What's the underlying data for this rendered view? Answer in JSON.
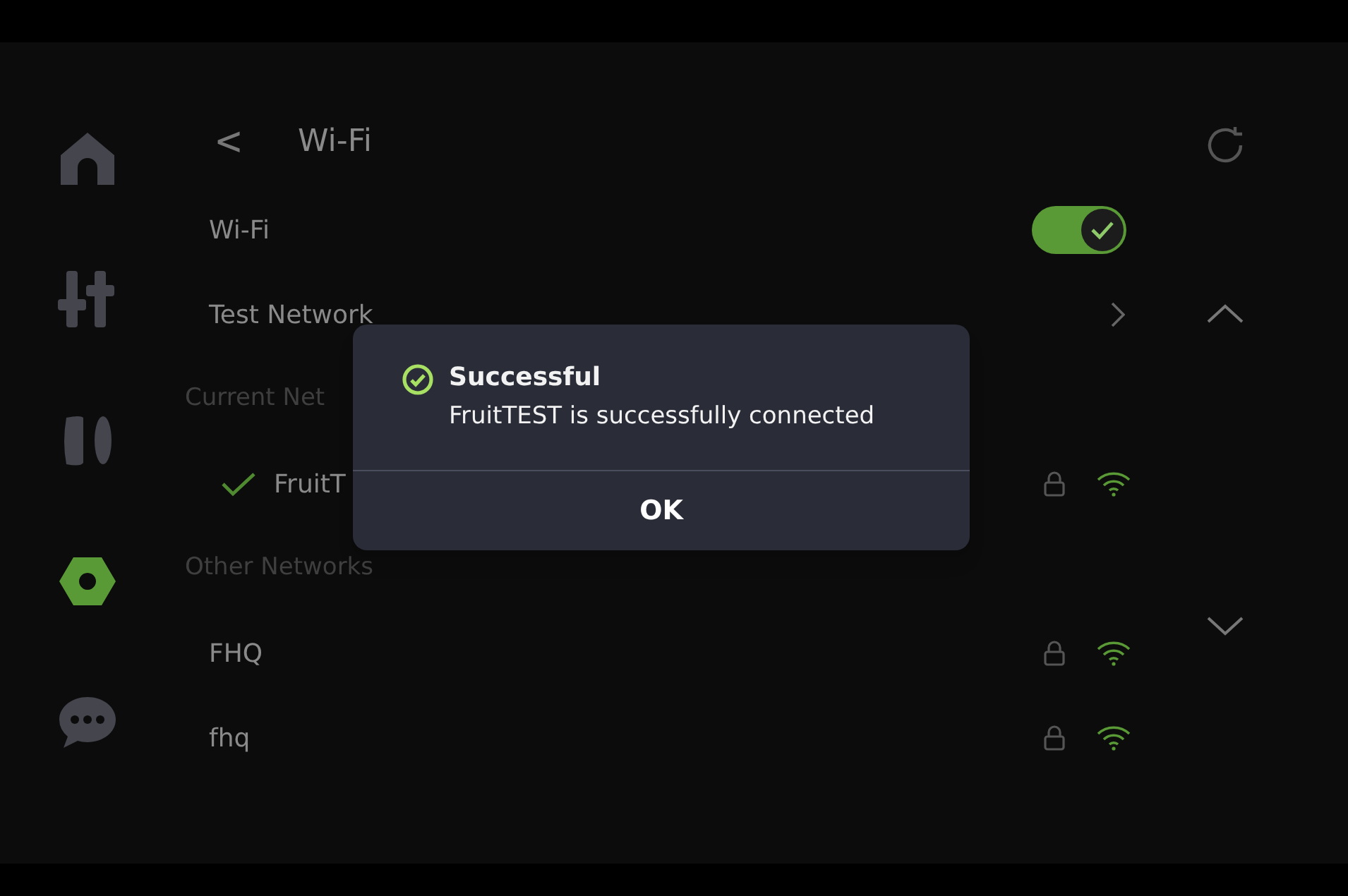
{
  "sidebar": {
    "items": [
      {
        "kind": "home",
        "selected": false
      },
      {
        "kind": "sliders",
        "selected": false
      },
      {
        "kind": "spool",
        "selected": false
      },
      {
        "kind": "nut",
        "selected": true
      },
      {
        "kind": "chat",
        "selected": false
      }
    ]
  },
  "header": {
    "back": "<",
    "title": "Wi-Fi"
  },
  "wifi_toggle": {
    "label": "Wi-Fi",
    "on": true
  },
  "test_network": {
    "label": "Test Network"
  },
  "current_network": {
    "section_label": "Current Net",
    "networks": [
      {
        "name": "FruitT",
        "connected": true,
        "secured": true
      }
    ]
  },
  "other_networks": {
    "section_label": "Other Networks",
    "networks": [
      {
        "name": "FHQ",
        "connected": false,
        "secured": true
      },
      {
        "name": "fhq",
        "connected": false,
        "secured": true
      }
    ]
  },
  "dialog": {
    "title": "Successful",
    "message": "FruitTEST is successfully connected",
    "button": "OK"
  }
}
